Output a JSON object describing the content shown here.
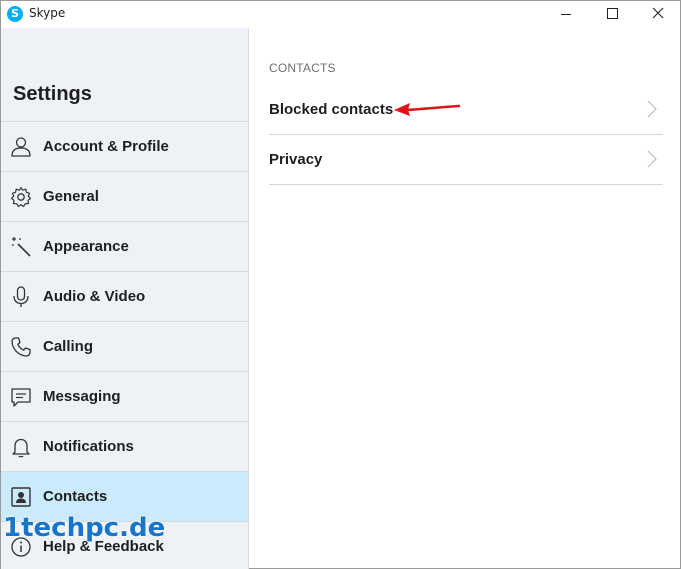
{
  "window": {
    "title": "Skype",
    "app_icon_letter": "S",
    "minimize_icon": "minimize-icon",
    "maximize_icon": "maximize-icon",
    "close_icon": "close-icon"
  },
  "sidebar": {
    "title": "Settings",
    "items": [
      {
        "label": "Account & Profile",
        "icon": "person-icon",
        "active": false
      },
      {
        "label": "General",
        "icon": "gear-icon",
        "active": false
      },
      {
        "label": "Appearance",
        "icon": "magic-wand-icon",
        "active": false
      },
      {
        "label": "Audio & Video",
        "icon": "microphone-icon",
        "active": false
      },
      {
        "label": "Calling",
        "icon": "phone-icon",
        "active": false
      },
      {
        "label": "Messaging",
        "icon": "message-icon",
        "active": false
      },
      {
        "label": "Notifications",
        "icon": "bell-icon",
        "active": false
      },
      {
        "label": "Contacts",
        "icon": "contact-card-icon",
        "active": true
      },
      {
        "label": "Help & Feedback",
        "icon": "info-icon",
        "active": false
      }
    ]
  },
  "main": {
    "section_heading": "CONTACTS",
    "rows": [
      {
        "label": "Blocked contacts"
      },
      {
        "label": "Privacy"
      }
    ]
  },
  "annotation": {
    "arrow_color": "#e0131a"
  },
  "watermark": {
    "text": "1techpc.de"
  },
  "colors": {
    "active_item": "#c9ebfb",
    "sidebar_bg": "#eef1f6",
    "skype_blue": "#00aff0"
  }
}
